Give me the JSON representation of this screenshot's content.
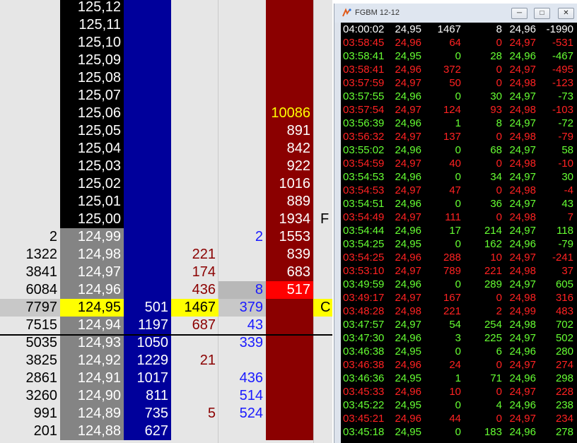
{
  "colors": {
    "price_black": "#000000",
    "price_gray": "#848484",
    "price_yellow": "#ffff00",
    "bid_blue": "#00009b",
    "ask_red": "#8b0000",
    "bright_red": "#ff0000",
    "blue_text": "#1a1aff",
    "red_text": "#8b0000",
    "last_yellow_text": "#ffff00",
    "ts_green": "#66ff33",
    "ts_red": "#ff2222",
    "ts_white": "#ffffff"
  },
  "ladder": {
    "rows": [
      {
        "left": "",
        "price": "125,12",
        "blue": "",
        "vol": "",
        "right": "",
        "red": "",
        "trail": "",
        "price_style": "black"
      },
      {
        "left": "",
        "price": "125,11",
        "blue": "",
        "vol": "",
        "right": "",
        "red": "",
        "trail": "",
        "price_style": "black"
      },
      {
        "left": "",
        "price": "125,10",
        "blue": "",
        "vol": "",
        "right": "",
        "red": "",
        "trail": "",
        "price_style": "black"
      },
      {
        "left": "",
        "price": "125,09",
        "blue": "",
        "vol": "",
        "right": "",
        "red": "",
        "trail": "",
        "price_style": "black"
      },
      {
        "left": "",
        "price": "125,08",
        "blue": "",
        "vol": "",
        "right": "",
        "red": "",
        "trail": "",
        "price_style": "black"
      },
      {
        "left": "",
        "price": "125,07",
        "blue": "",
        "vol": "",
        "right": "",
        "red": "",
        "trail": "",
        "price_style": "black"
      },
      {
        "left": "",
        "price": "125,06",
        "blue": "",
        "vol": "",
        "right": "",
        "red": "10086",
        "trail": "",
        "price_style": "black",
        "red_text": "yellow"
      },
      {
        "left": "",
        "price": "125,05",
        "blue": "",
        "vol": "",
        "right": "",
        "red": "891",
        "trail": "",
        "price_style": "black"
      },
      {
        "left": "",
        "price": "125,04",
        "blue": "",
        "vol": "",
        "right": "",
        "red": "842",
        "trail": "",
        "price_style": "black"
      },
      {
        "left": "",
        "price": "125,03",
        "blue": "",
        "vol": "",
        "right": "",
        "red": "922",
        "trail": "",
        "price_style": "black"
      },
      {
        "left": "",
        "price": "125,02",
        "blue": "",
        "vol": "",
        "right": "",
        "red": "1016",
        "trail": "",
        "price_style": "black"
      },
      {
        "left": "",
        "price": "125,01",
        "blue": "",
        "vol": "",
        "right": "",
        "red": "889",
        "trail": "",
        "price_style": "black"
      },
      {
        "left": "",
        "price": "125,00",
        "blue": "",
        "vol": "",
        "right": "",
        "red": "1934",
        "trail": "F",
        "price_style": "black"
      },
      {
        "left": "2",
        "price": "124,99",
        "blue": "",
        "vol": "",
        "right": "2",
        "red": "1553",
        "trail": "",
        "price_style": "gray"
      },
      {
        "left": "1322",
        "price": "124,98",
        "blue": "",
        "vol": "221",
        "right": "",
        "red": "839",
        "trail": "",
        "price_style": "gray"
      },
      {
        "left": "3841",
        "price": "124,97",
        "blue": "",
        "vol": "174",
        "right": "",
        "red": "683",
        "trail": "",
        "price_style": "gray"
      },
      {
        "left": "6084",
        "price": "124,96",
        "blue": "",
        "vol": "436",
        "right": "8",
        "red": "517",
        "trail": "",
        "price_style": "gray",
        "red_bg": "bright",
        "right_bg": "gray"
      },
      {
        "left": "7797",
        "price": "124,95",
        "blue": "501",
        "vol": "1467",
        "right": "379",
        "red": "",
        "trail": "C",
        "price_style": "yellow",
        "row_bg": "gray",
        "vol_bg": "yellow",
        "trail_bg": "yellow"
      },
      {
        "left": "7515",
        "price": "124,94",
        "blue": "1197",
        "vol": "687",
        "right": "43",
        "red": "",
        "trail": "",
        "price_style": "gray"
      },
      {
        "left": "5035",
        "price": "124,93",
        "blue": "1050",
        "vol": "",
        "right": "339",
        "red": "",
        "trail": "",
        "price_style": "gray"
      },
      {
        "left": "3825",
        "price": "124,92",
        "blue": "1229",
        "vol": "21",
        "right": "",
        "red": "",
        "trail": "",
        "price_style": "gray"
      },
      {
        "left": "2861",
        "price": "124,91",
        "blue": "1017",
        "vol": "",
        "right": "436",
        "red": "",
        "trail": "",
        "price_style": "gray"
      },
      {
        "left": "3260",
        "price": "124,90",
        "blue": "811",
        "vol": "",
        "right": "514",
        "red": "",
        "trail": "",
        "price_style": "gray"
      },
      {
        "left": "991",
        "price": "124,89",
        "blue": "735",
        "vol": "5",
        "right": "524",
        "red": "",
        "trail": "",
        "price_style": "gray"
      },
      {
        "left": "201",
        "price": "124,88",
        "blue": "627",
        "vol": "",
        "right": "",
        "red": "",
        "trail": "",
        "price_style": "gray"
      }
    ]
  },
  "time_sales": {
    "title": "FGBM 12-12",
    "rows": [
      {
        "time": "04:00:02",
        "bid": "24,95",
        "bsz": "1467",
        "asz": "8",
        "ask": "24,96",
        "chg": "-1990",
        "color": "white"
      },
      {
        "time": "03:58:45",
        "bid": "24,96",
        "bsz": "64",
        "asz": "0",
        "ask": "24,97",
        "chg": "-531",
        "color": "red"
      },
      {
        "time": "03:58:41",
        "bid": "24,95",
        "bsz": "0",
        "asz": "28",
        "ask": "24,96",
        "chg": "-467",
        "color": "green"
      },
      {
        "time": "03:58:41",
        "bid": "24,96",
        "bsz": "372",
        "asz": "0",
        "ask": "24,97",
        "chg": "-495",
        "color": "red"
      },
      {
        "time": "03:57:59",
        "bid": "24,97",
        "bsz": "50",
        "asz": "0",
        "ask": "24,98",
        "chg": "-123",
        "color": "red"
      },
      {
        "time": "03:57:55",
        "bid": "24,96",
        "bsz": "0",
        "asz": "30",
        "ask": "24,97",
        "chg": "-73",
        "color": "green"
      },
      {
        "time": "03:57:54",
        "bid": "24,97",
        "bsz": "124",
        "asz": "93",
        "ask": "24,98",
        "chg": "-103",
        "color": "red"
      },
      {
        "time": "03:56:39",
        "bid": "24,96",
        "bsz": "1",
        "asz": "8",
        "ask": "24,97",
        "chg": "-72",
        "color": "green"
      },
      {
        "time": "03:56:32",
        "bid": "24,97",
        "bsz": "137",
        "asz": "0",
        "ask": "24,98",
        "chg": "-79",
        "color": "red"
      },
      {
        "time": "03:55:02",
        "bid": "24,96",
        "bsz": "0",
        "asz": "68",
        "ask": "24,97",
        "chg": "58",
        "color": "green"
      },
      {
        "time": "03:54:59",
        "bid": "24,97",
        "bsz": "40",
        "asz": "0",
        "ask": "24,98",
        "chg": "-10",
        "color": "red"
      },
      {
        "time": "03:54:53",
        "bid": "24,96",
        "bsz": "0",
        "asz": "34",
        "ask": "24,97",
        "chg": "30",
        "color": "green"
      },
      {
        "time": "03:54:53",
        "bid": "24,97",
        "bsz": "47",
        "asz": "0",
        "ask": "24,98",
        "chg": "-4",
        "color": "red"
      },
      {
        "time": "03:54:51",
        "bid": "24,96",
        "bsz": "0",
        "asz": "36",
        "ask": "24,97",
        "chg": "43",
        "color": "green"
      },
      {
        "time": "03:54:49",
        "bid": "24,97",
        "bsz": "111",
        "asz": "0",
        "ask": "24,98",
        "chg": "7",
        "color": "red"
      },
      {
        "time": "03:54:44",
        "bid": "24,96",
        "bsz": "17",
        "asz": "214",
        "ask": "24,97",
        "chg": "118",
        "color": "green"
      },
      {
        "time": "03:54:25",
        "bid": "24,95",
        "bsz": "0",
        "asz": "162",
        "ask": "24,96",
        "chg": "-79",
        "color": "green"
      },
      {
        "time": "03:54:25",
        "bid": "24,96",
        "bsz": "288",
        "asz": "10",
        "ask": "24,97",
        "chg": "-241",
        "color": "red"
      },
      {
        "time": "03:53:10",
        "bid": "24,97",
        "bsz": "789",
        "asz": "221",
        "ask": "24,98",
        "chg": "37",
        "color": "red"
      },
      {
        "time": "03:49:59",
        "bid": "24,96",
        "bsz": "0",
        "asz": "289",
        "ask": "24,97",
        "chg": "605",
        "color": "green"
      },
      {
        "time": "03:49:17",
        "bid": "24,97",
        "bsz": "167",
        "asz": "0",
        "ask": "24,98",
        "chg": "316",
        "color": "red"
      },
      {
        "time": "03:48:28",
        "bid": "24,98",
        "bsz": "221",
        "asz": "2",
        "ask": "24,99",
        "chg": "483",
        "color": "red"
      },
      {
        "time": "03:47:57",
        "bid": "24,97",
        "bsz": "54",
        "asz": "254",
        "ask": "24,98",
        "chg": "702",
        "color": "green"
      },
      {
        "time": "03:47:30",
        "bid": "24,96",
        "bsz": "3",
        "asz": "225",
        "ask": "24,97",
        "chg": "502",
        "color": "green"
      },
      {
        "time": "03:46:38",
        "bid": "24,95",
        "bsz": "0",
        "asz": "6",
        "ask": "24,96",
        "chg": "280",
        "color": "green"
      },
      {
        "time": "03:46:38",
        "bid": "24,96",
        "bsz": "24",
        "asz": "0",
        "ask": "24,97",
        "chg": "274",
        "color": "red"
      },
      {
        "time": "03:46:36",
        "bid": "24,95",
        "bsz": "1",
        "asz": "71",
        "ask": "24,96",
        "chg": "298",
        "color": "green"
      },
      {
        "time": "03:45:33",
        "bid": "24,96",
        "bsz": "10",
        "asz": "0",
        "ask": "24,97",
        "chg": "228",
        "color": "red"
      },
      {
        "time": "03:45:22",
        "bid": "24,95",
        "bsz": "0",
        "asz": "4",
        "ask": "24,96",
        "chg": "238",
        "color": "green"
      },
      {
        "time": "03:45:21",
        "bid": "24,96",
        "bsz": "44",
        "asz": "0",
        "ask": "24,97",
        "chg": "234",
        "color": "red"
      },
      {
        "time": "03:45:18",
        "bid": "24,95",
        "bsz": "0",
        "asz": "183",
        "ask": "24,96",
        "chg": "278",
        "color": "green"
      }
    ]
  }
}
